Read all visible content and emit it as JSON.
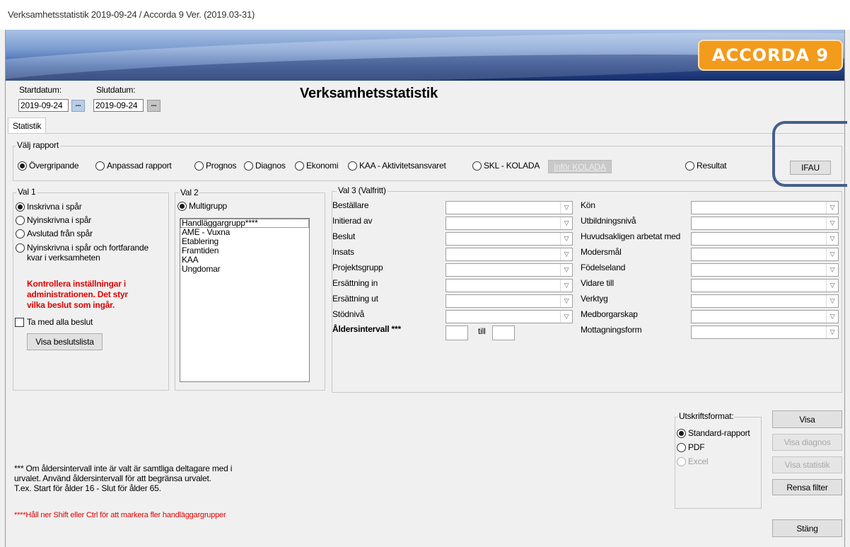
{
  "window": {
    "title": "Verksamhetsstatistik 2019-09-24 / Accorda 9 Ver. (2019.03-31)"
  },
  "logo": "ACCORDA 9",
  "header": {
    "start_label": "Startdatum:",
    "start_value": "2019-09-24",
    "end_label": "Slutdatum:",
    "end_value": "2019-09-24",
    "date_btn": "...",
    "title": "Verksamhetsstatistik"
  },
  "tab": "Statistik",
  "report": {
    "group_title": "Välj rapport",
    "options": [
      "Övergripande",
      "Anpassad rapport",
      "Prognos",
      "Diagnos",
      "Ekonomi",
      "KAA - Aktivitetsansvaret",
      "SKL - KOLADA"
    ],
    "selected": "Övergripande",
    "kolada_button": "Inför KOLADA",
    "result_option": "Resultat",
    "ifau_button": "IFAU"
  },
  "val1": {
    "title": "Val 1",
    "options": [
      "Inskrivna i spår",
      "Nyinskrivna i spår",
      "Avslutad från spår",
      "Nyinskrivna i spår och fortfarande",
      "kvar i verksamheten"
    ],
    "warning": [
      "Kontrollera inställningar i",
      "administrationen. Det styr",
      "vilka beslut som ingår."
    ],
    "checkbox_label": "Ta med alla beslut",
    "button": "Visa beslutslista"
  },
  "val2": {
    "title": "Val 2",
    "radio": "Multigrupp",
    "items": [
      "Handläggargrupp****",
      "AME - Vuxna",
      "Etablering",
      "Framtiden",
      "KAA",
      "Ungdomar"
    ]
  },
  "val3": {
    "title": "Val 3 (Valfritt)",
    "left": [
      "Beställare",
      "Initierad av",
      "Beslut",
      "Insats",
      "Projektsgrupp",
      "Ersättning in",
      "Ersättning ut",
      "Stödnivå"
    ],
    "age_label": "Åldersintervall ***",
    "till": "till",
    "right": [
      "Kön",
      "Utbildningsnivå",
      "Huvudsakligen arbetat med",
      "Modersmål",
      "Födelseland",
      "Vidare till",
      "Verktyg",
      "Medborgarskap",
      "Mottagningsform"
    ]
  },
  "print": {
    "title": "Utskriftsformat:",
    "options": [
      "Standard-rapport",
      "PDF",
      "Excel"
    ]
  },
  "buttons": {
    "visa": "Visa",
    "visa_diagnos": "Visa diagnos",
    "visa_statistik": "Visa statistik",
    "rensa": "Rensa filter",
    "stang": "Stäng"
  },
  "notes": {
    "age_note": [
      "*** Om åldersintervall inte är valt är samtliga deltagare med i",
      "urvalet. Använd åldersintervall för att begränsa urvalet.",
      "T.ex. Start för ålder 16 - Slut för ålder 65."
    ],
    "group_note": "****Håll ner Shift eller Ctrl för att markera fler handläggargrupper"
  }
}
